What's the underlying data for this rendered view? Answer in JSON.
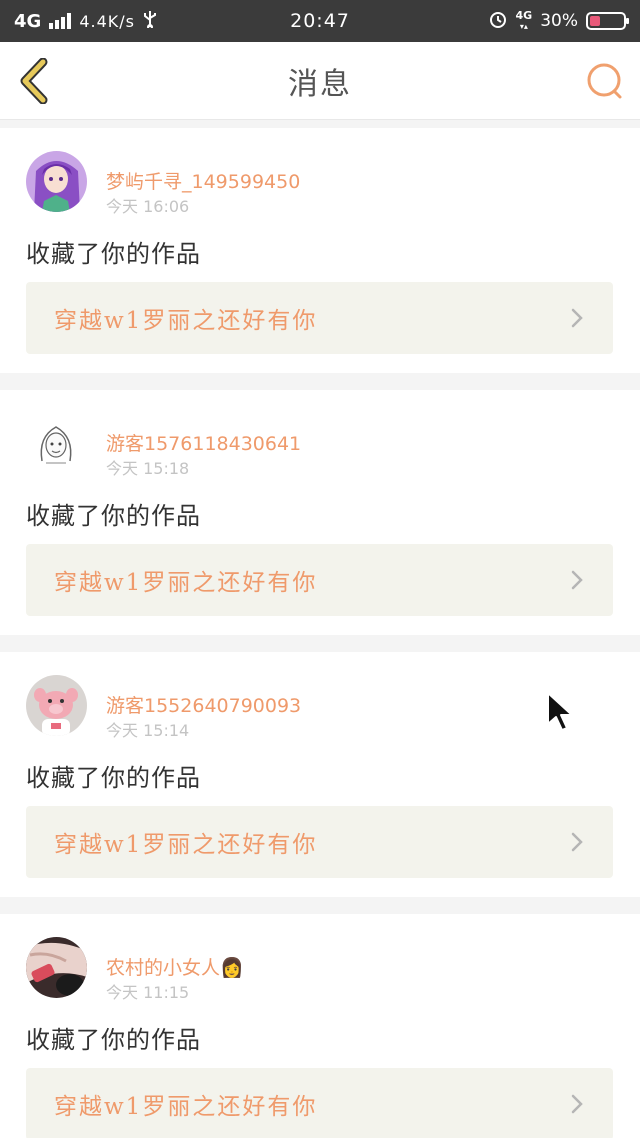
{
  "status_bar": {
    "network": "4G",
    "speed": "4.4K/s",
    "time": "20:47",
    "network2": "4G",
    "battery": "30%"
  },
  "header": {
    "title": "消息"
  },
  "colors": {
    "accent": "#ef9a6b",
    "back_icon": "#e6c95a",
    "card_link_bg": "#f3f3ec"
  },
  "feed": {
    "items": [
      {
        "user": "梦屿千寻_149599450",
        "time": "今天 16:06",
        "action": "收藏了你的作品",
        "work_title": "穿越w1罗丽之还好有你",
        "avatar_icon": "anime-girl-avatar"
      },
      {
        "user": "游客1576118430641",
        "time": "今天 15:18",
        "action": "收藏了你的作品",
        "work_title": "穿越w1罗丽之还好有你",
        "avatar_icon": "sketch-girl-avatar"
      },
      {
        "user": "游客1552640790093",
        "time": "今天 15:14",
        "action": "收藏了你的作品",
        "work_title": "穿越w1罗丽之还好有你",
        "avatar_icon": "pink-toy-avatar"
      },
      {
        "user": "农村的小女人👩",
        "time": "今天 11:15",
        "action": "收藏了你的作品",
        "work_title": "穿越w1罗丽之还好有你",
        "avatar_icon": "photo-avatar"
      }
    ]
  }
}
